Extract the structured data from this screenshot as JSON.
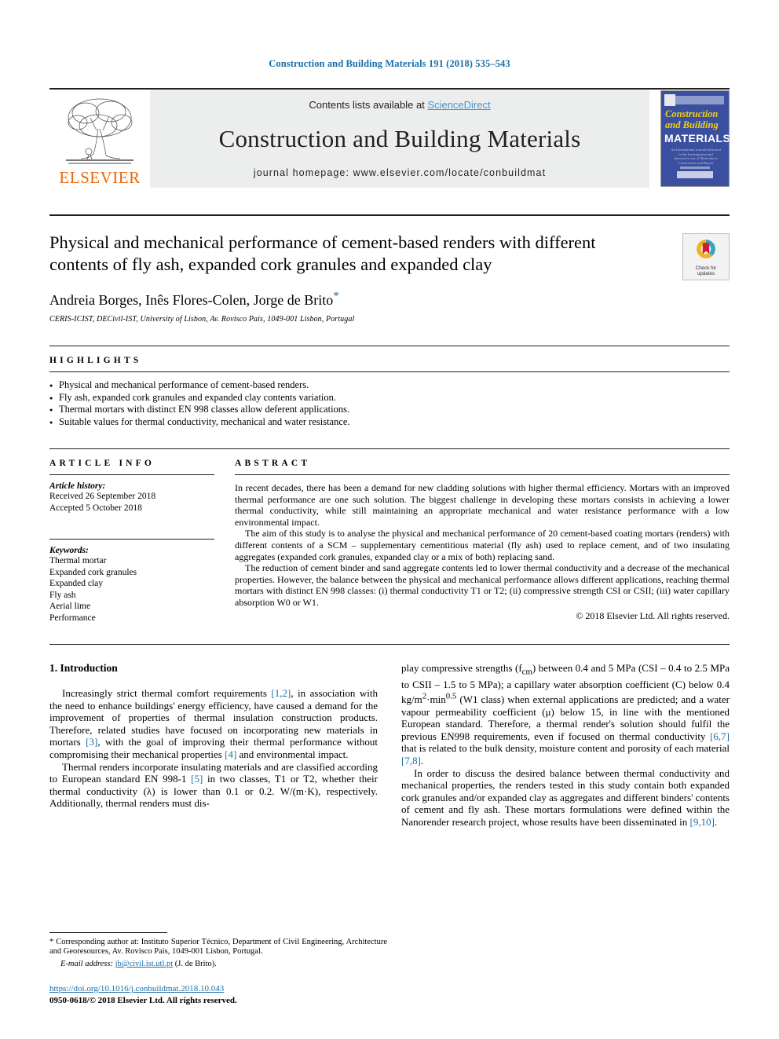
{
  "running_head": "Construction and Building Materials 191 (2018) 535–543",
  "masthead": {
    "publisher_name": "ELSEVIER",
    "contents_prefix": "Contents lists available at ",
    "contents_link": "ScienceDirect",
    "journal_title": "Construction and Building Materials",
    "homepage": "journal homepage: www.elsevier.com/locate/conbuildmat",
    "cover": {
      "line1": "Construction",
      "line2": "and Building",
      "line3": "MATERIALS",
      "blurb": "An International Journal dedicated to the Investigation and Innovative use of Materials in Construction and Repair"
    }
  },
  "article": {
    "title": "Physical and mechanical performance of cement-based renders with different contents of fly ash, expanded cork granules and expanded clay",
    "authors": "Andreia Borges, Inês Flores-Colen, Jorge de Brito",
    "corresponding_mark": "*",
    "affiliation": "CERIS-ICIST, DECivil-IST, University of Lisbon, Av. Rovisco Pais, 1049-001 Lisbon, Portugal",
    "crossmark": {
      "line1": "Check for",
      "line2": "updates"
    }
  },
  "highlights": {
    "heading": "HIGHLIGHTS",
    "items": [
      "Physical and mechanical performance of cement-based renders.",
      "Fly ash, expanded cork granules and expanded clay contents variation.",
      "Thermal mortars with distinct EN 998 classes allow deferent applications.",
      "Suitable values for thermal conductivity, mechanical and water resistance."
    ]
  },
  "article_info": {
    "heading": "ARTICLE INFO",
    "history_label": "Article history:",
    "history": [
      "Received 26 September 2018",
      "Accepted 5 October 2018"
    ],
    "keywords_label": "Keywords:",
    "keywords": [
      "Thermal mortar",
      "Expanded cork granules",
      "Expanded clay",
      "Fly ash",
      "Aerial lime",
      "Performance"
    ]
  },
  "abstract": {
    "heading": "ABSTRACT",
    "paragraphs": [
      "In recent decades, there has been a demand for new cladding solutions with higher thermal efficiency. Mortars with an improved thermal performance are one such solution. The biggest challenge in developing these mortars consists in achieving a lower thermal conductivity, while still maintaining an appropriate mechanical and water resistance performance with a low environmental impact.",
      "The aim of this study is to analyse the physical and mechanical performance of 20 cement-based coating mortars (renders) with different contents of a SCM – supplementary cementitious material (fly ash) used to replace cement, and of two insulating aggregates (expanded cork granules, expanded clay or a mix of both) replacing sand.",
      "The reduction of cement binder and sand aggregate contents led to lower thermal conductivity and a decrease of the mechanical properties. However, the balance between the physical and mechanical performance allows different applications, reaching thermal mortars with distinct EN 998 classes: (i) thermal conductivity T1 or T2; (ii) compressive strength CSI or CSII; (iii) water capillary absorption W0 or W1."
    ],
    "copyright": "© 2018 Elsevier Ltd. All rights reserved."
  },
  "introduction": {
    "heading": "1. Introduction",
    "left_paragraphs": [
      "Increasingly strict thermal comfort requirements [1,2], in association with the need to enhance buildings' energy efficiency, have caused a demand for the improvement of properties of thermal insulation construction products. Therefore, related studies have focused on incorporating new materials in mortars [3], with the goal of improving their thermal performance without compromising their mechanical properties [4] and environmental impact.",
      "Thermal renders incorporate insulating materials and are classified according to European standard EN 998-1 [5] in two classes, T1 or T2, whether their thermal conductivity (λ) is lower than 0.1 or 0.2. W/(m·K), respectively. Additionally, thermal renders must dis-"
    ],
    "right_paragraphs": [
      "play compressive strengths (fcm) between 0.4 and 5 MPa (CSI – 0.4 to 2.5 MPa to CSII – 1.5 to 5 MPa); a capillary water absorption coefficient (C) below 0.4 kg/m2·min0.5 (W1 class) when external applications are predicted; and a water vapour permeability coefficient (μ) below 15, in line with the mentioned European standard. Therefore, a thermal render's solution should fulfil the previous EN998 requirements, even if focused on thermal conductivity [6,7] that is related to the bulk density, moisture content and porosity of each material [7,8].",
      "In order to discuss the desired balance between thermal conductivity and mechanical properties, the renders tested in this study contain both expanded cork granules and/or expanded clay as aggregates and different binders' contents of cement and fly ash. These mortars formulations were defined within the Nanorender research project, whose results have been disseminated in [9,10]."
    ]
  },
  "footnote": {
    "corresponding": "* Corresponding author at: Instituto Superior Técnico, Department of Civil Engineering, Architecture and Georesources, Av. Rovisco Pais, 1049-001 Lisbon, Portugal.",
    "email_label": "E-mail address:",
    "email": "jb@civil.ist.utl.pt",
    "email_suffix": "(J. de Brito).",
    "doi": "https://doi.org/10.1016/j.conbuildmat.2018.10.043",
    "issn": "0950-0618/© 2018 Elsevier Ltd. All rights reserved."
  },
  "colors": {
    "link": "#1a6ea8",
    "sciencedirect": "#3d9ad1",
    "elsevier_orange": "#ec6608",
    "masthead_bg": "#eceded"
  }
}
